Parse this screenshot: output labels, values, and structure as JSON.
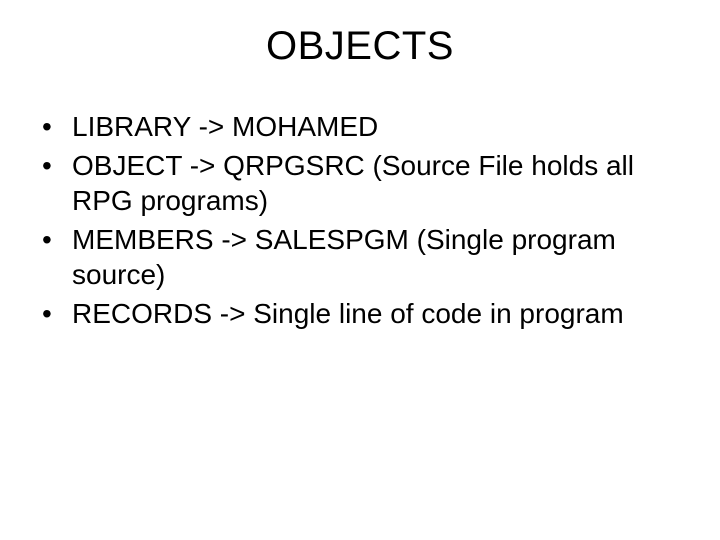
{
  "title": "OBJECTS",
  "bullets": [
    "LIBRARY ->  MOHAMED",
    "OBJECT  ->  QRPGSRC (Source File holds all RPG programs)",
    "MEMBERS -> SALESPGM (Single program source)",
    "RECORDS -> Single line of code in program"
  ]
}
